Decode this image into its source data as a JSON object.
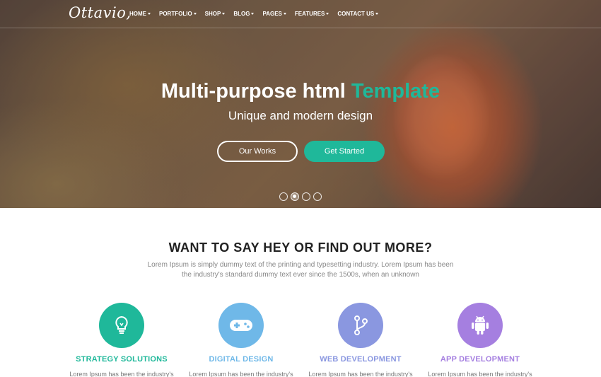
{
  "brand": {
    "logo": "Ottavio,"
  },
  "nav": {
    "items": [
      {
        "label": "HOME"
      },
      {
        "label": "PORTFOLIO"
      },
      {
        "label": "SHOP"
      },
      {
        "label": "BLOG"
      },
      {
        "label": "PAGES"
      },
      {
        "label": "FEATURES"
      },
      {
        "label": "CONTACT US"
      }
    ]
  },
  "hero": {
    "title_main": "Multi-purpose html ",
    "title_accent": "Template",
    "subtitle": "Unique and modern design",
    "btn_primary": "Our Works",
    "btn_secondary": "Get Started",
    "slides_count": 4,
    "active_slide": 2
  },
  "intro": {
    "title": "WANT TO SAY HEY OR FIND OUT MORE?",
    "text": "Lorem Ipsum is simply dummy text of the printing and typesetting industry. Lorem Ipsum has been the industry's standard dummy text ever since the 1500s, when an unknown"
  },
  "features": [
    {
      "title": "STRATEGY SOLUTIONS",
      "text": "Lorem Ipsum has been the industry's",
      "icon": "lightbulb-icon",
      "color": "#1fb89a"
    },
    {
      "title": "DIGITAL DESIGN",
      "text": "Lorem Ipsum has been the industry's",
      "icon": "gamepad-icon",
      "color": "#6fb8e8"
    },
    {
      "title": "WEB DEVELOPMENT",
      "text": "Lorem Ipsum has been the industry's",
      "icon": "git-branch-icon",
      "color": "#8a97e0"
    },
    {
      "title": "APP DEVELOPMENT",
      "text": "Lorem Ipsum has been the industry's",
      "icon": "android-icon",
      "color": "#a57fe0"
    }
  ],
  "colors": {
    "accent": "#1fb89a"
  }
}
